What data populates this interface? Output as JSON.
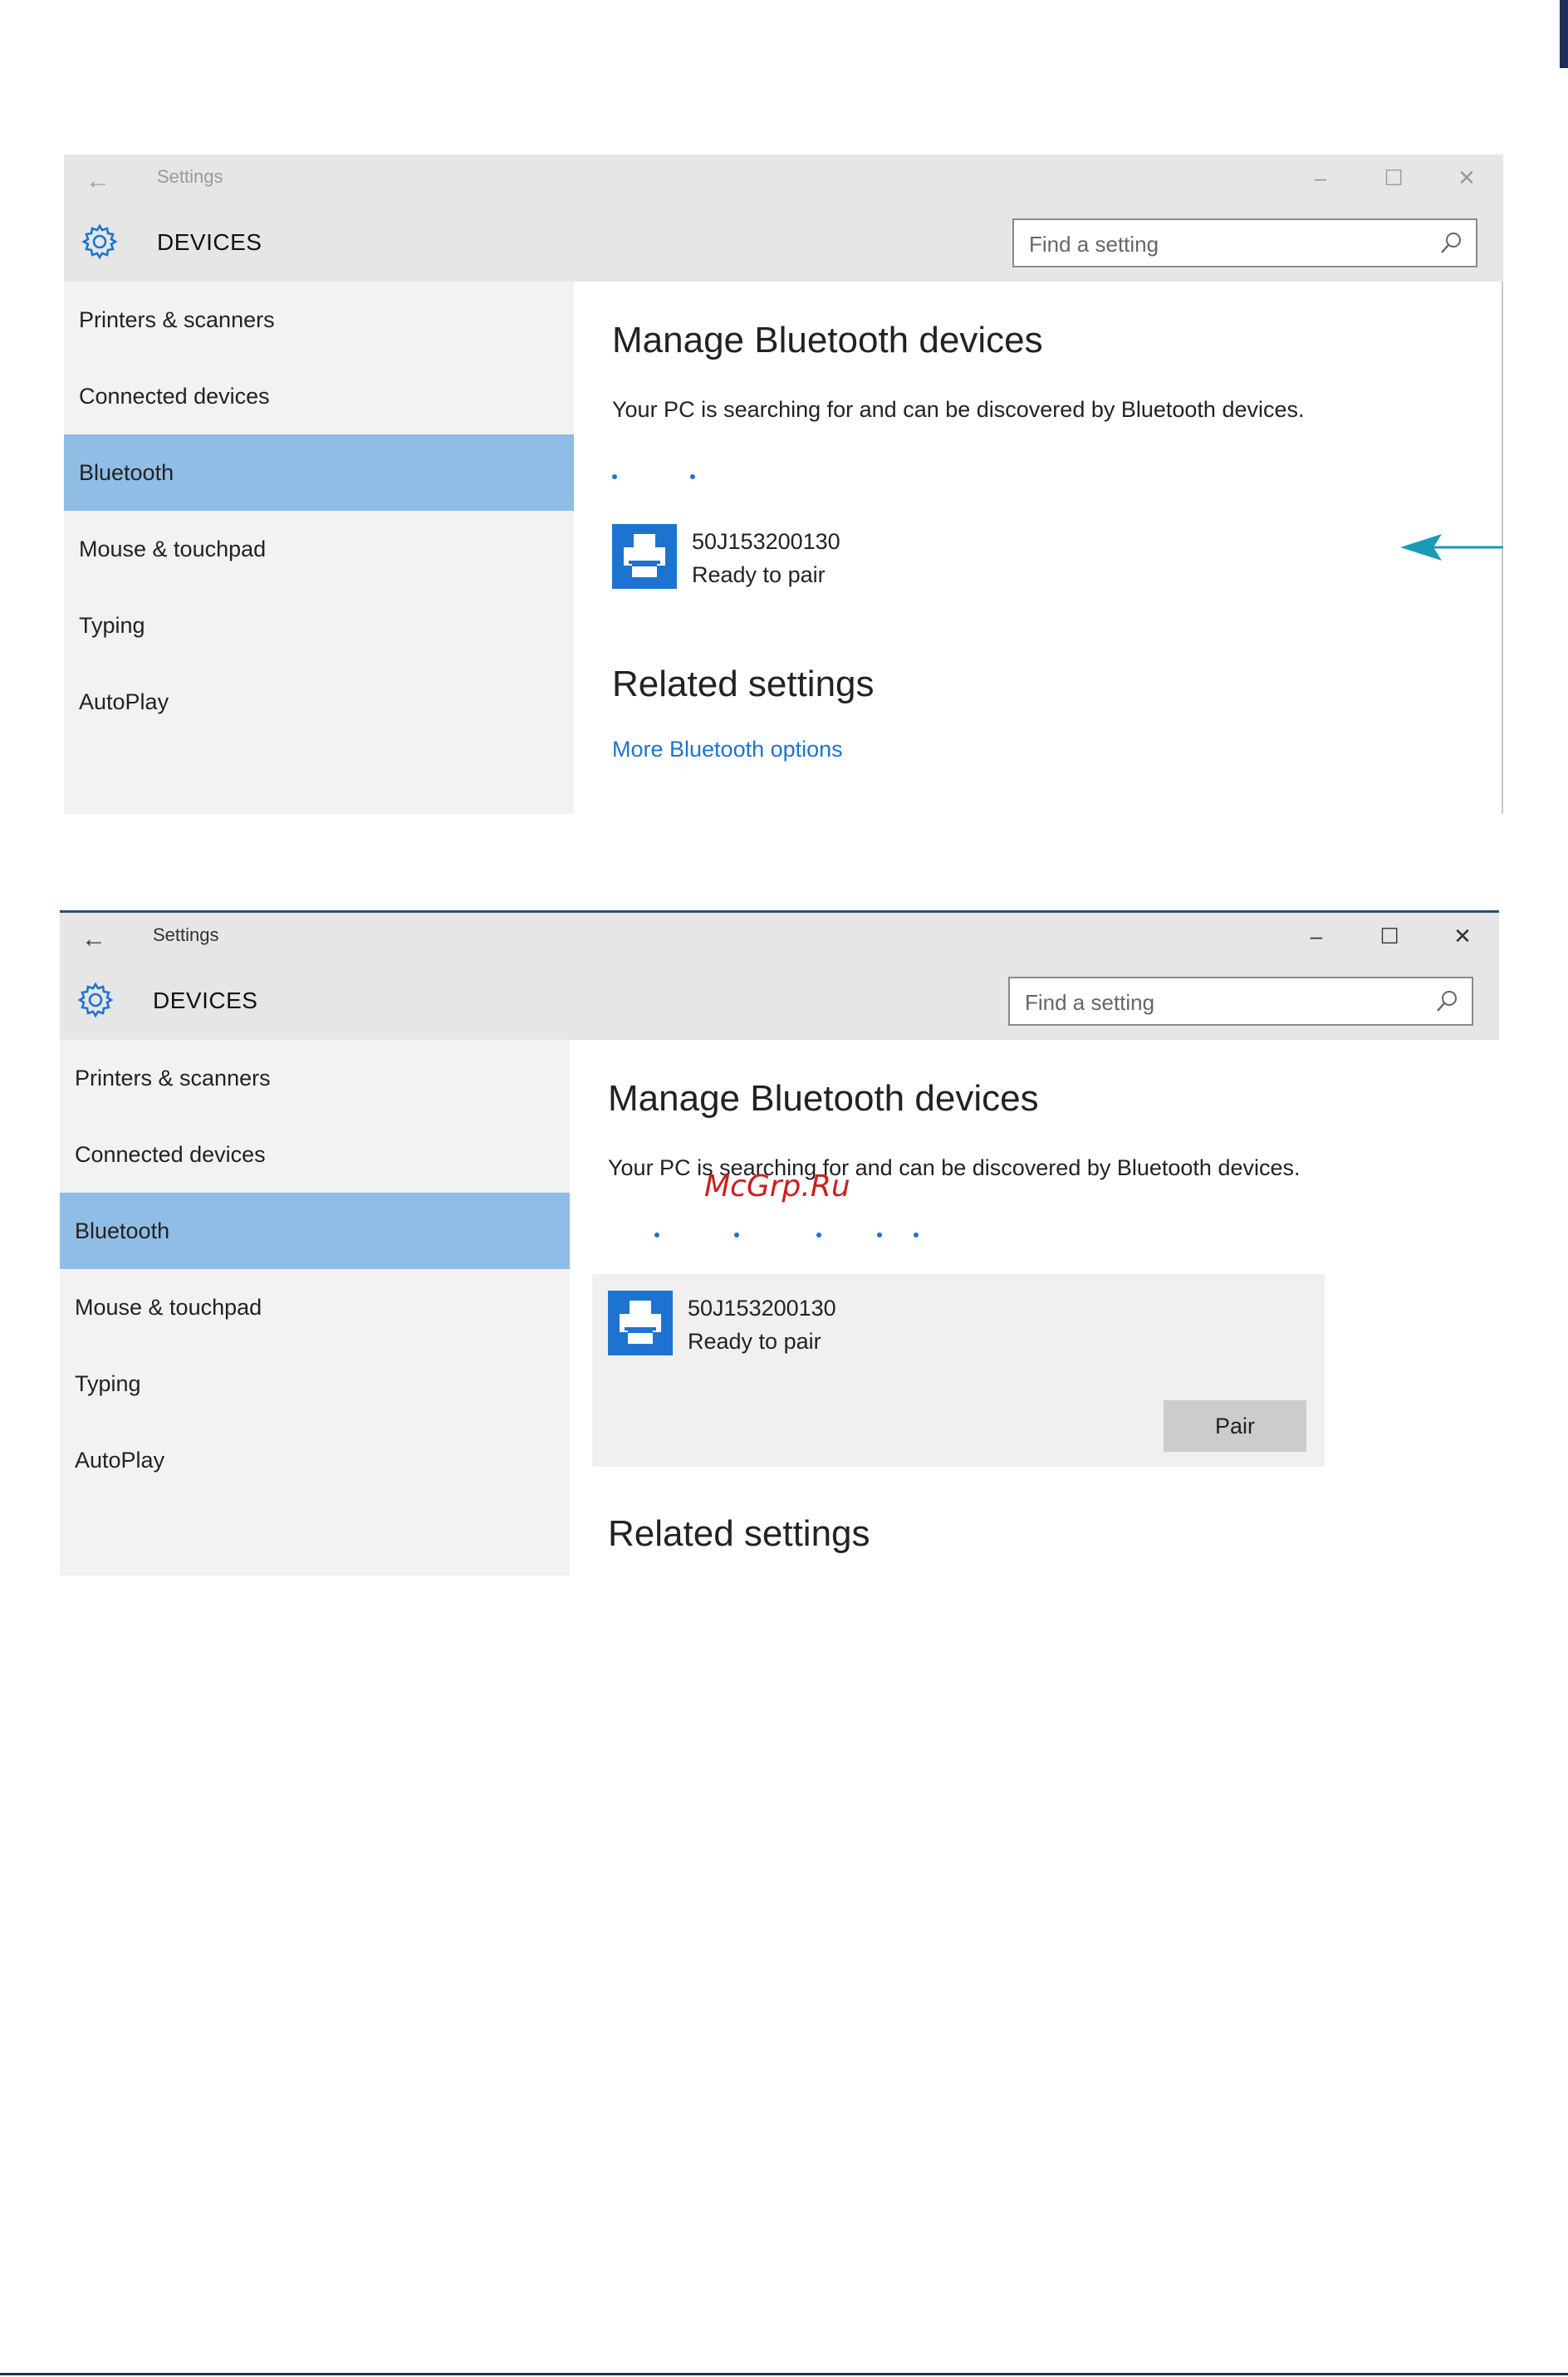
{
  "windows": [
    {
      "title": "Settings",
      "section": "DEVICES",
      "search_placeholder": "Find a setting",
      "nav": [
        "Printers & scanners",
        "Connected devices",
        "Bluetooth",
        "Mouse & touchpad",
        "Typing",
        "AutoPlay"
      ],
      "active_nav": "Bluetooth",
      "heading": "Manage Bluetooth devices",
      "status_text": "Your PC is searching for and can be discovered by Bluetooth devices.",
      "device": {
        "name": "50J153200130",
        "status": "Ready to pair"
      },
      "related_heading": "Related settings",
      "related_link": "More Bluetooth options"
    },
    {
      "title": "Settings",
      "section": "DEVICES",
      "search_placeholder": "Find a setting",
      "nav": [
        "Printers & scanners",
        "Connected devices",
        "Bluetooth",
        "Mouse & touchpad",
        "Typing",
        "AutoPlay"
      ],
      "active_nav": "Bluetooth",
      "heading": "Manage Bluetooth devices",
      "status_text": "Your PC is searching for and can be discovered by Bluetooth devices.",
      "device": {
        "name": "50J153200130",
        "status": "Ready to pair"
      },
      "pair_label": "Pair",
      "related_heading": "Related settings"
    }
  ],
  "watermark": "McGrp.Ru",
  "icons": {
    "back": "back-arrow-icon",
    "minimize": "minimize-icon",
    "maximize": "maximize-icon",
    "close": "close-icon",
    "settings": "gear-icon",
    "search": "search-icon",
    "device": "printer-icon"
  },
  "colors": {
    "accent": "#1e73d1",
    "active_nav": "#8fbde6",
    "callout_arrow": "#1a9bb5",
    "watermark": "#cc1f1f"
  }
}
